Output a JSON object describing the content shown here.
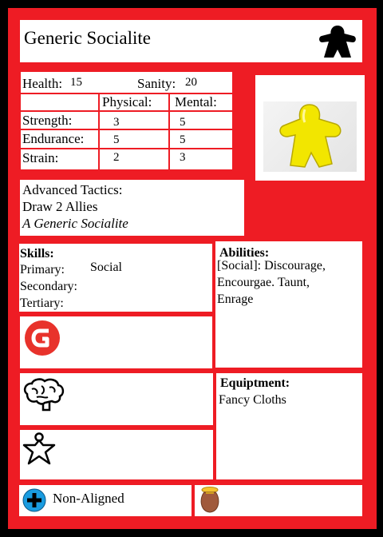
{
  "character": {
    "name": "Generic Socialite"
  },
  "stats": {
    "health_label": "Health:",
    "health_value": "15",
    "sanity_label": "Sanity:",
    "sanity_value": "20",
    "col_physical": "Physical:",
    "col_mental": "Mental:",
    "rows": [
      {
        "label": "Strength:",
        "physical": "3",
        "mental": "5"
      },
      {
        "label": "Endurance:",
        "physical": "5",
        "mental": "5"
      },
      {
        "label": "Strain:",
        "physical": "2",
        "mental": "3"
      }
    ]
  },
  "tactics": {
    "heading": "Advanced Tactics:",
    "effect": "Draw 2 Allies",
    "flavor": "A Generic Socialite"
  },
  "skills": {
    "heading": "Skills:",
    "primary_label": "Primary:",
    "primary_value": "Social",
    "secondary_label": "Secondary:",
    "tertiary_label": "Tertiary:"
  },
  "abilities": {
    "heading": "Abilities:",
    "text_line1": "[Social]: Discourage,",
    "text_line2": "Encourgae. Taunt,",
    "text_line3": "Enrage"
  },
  "equipment": {
    "heading": "Equiptment:",
    "item": "Fancy Cloths"
  },
  "alignment": {
    "label": "Non-Aligned"
  },
  "colors": {
    "card_border": "#ee1c24",
    "background": "#000000",
    "meeple_portrait": "#f2e600",
    "alignment_icon": "#1a9ce0",
    "g_icon": "#e8322b",
    "pouch_icon": "#a05a3c"
  },
  "icons": {
    "header": "meeple-icon",
    "portrait": "yellow-meeple-icon",
    "slot1": "g-logo-icon",
    "slot2": "brain-icon",
    "slot3": "star-person-icon",
    "alignment": "plus-circle-icon",
    "pouch": "coin-pouch-icon"
  }
}
